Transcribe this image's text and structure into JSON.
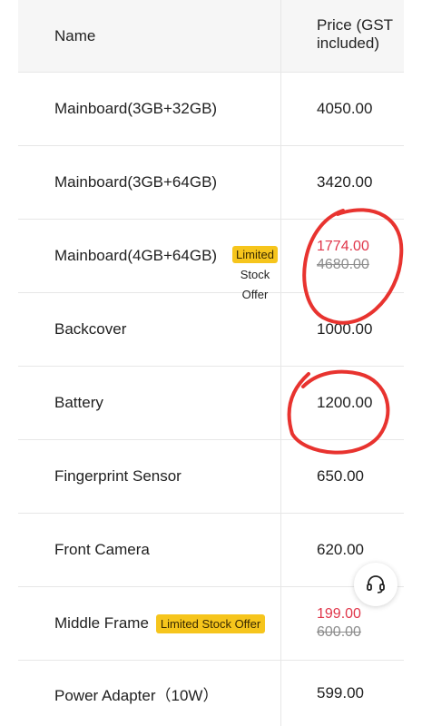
{
  "table": {
    "headers": {
      "name": "Name",
      "price": "Price (GST included)"
    },
    "rows": [
      {
        "name": "Mainboard(3GB+32GB)",
        "price": "4050.00"
      },
      {
        "name": "Mainboard(3GB+64GB)",
        "price": "3420.00"
      },
      {
        "name": "Mainboard(4GB+64GB)",
        "badge": "Limited Stock Offer",
        "badge_lines": [
          "Limited",
          "Stock",
          "Offer"
        ],
        "sale_price": "1774.00",
        "original_price": "4680.00"
      },
      {
        "name": "Backcover",
        "price": "1000.00"
      },
      {
        "name": "Battery",
        "price": "1200.00"
      },
      {
        "name": "Fingerprint Sensor",
        "price": "650.00"
      },
      {
        "name": "Front Camera",
        "price": "620.00"
      },
      {
        "name": "Middle Frame",
        "badge": "Limited Stock Offer",
        "sale_price": "199.00",
        "original_price": "600.00"
      },
      {
        "name": "Power Adapter（10W）",
        "price": "599.00"
      }
    ]
  },
  "support_button": {
    "icon": "headset-icon"
  },
  "colors": {
    "sale_price": "#e0364a",
    "badge": "#f6c51c",
    "annotation": "#e8332f"
  }
}
